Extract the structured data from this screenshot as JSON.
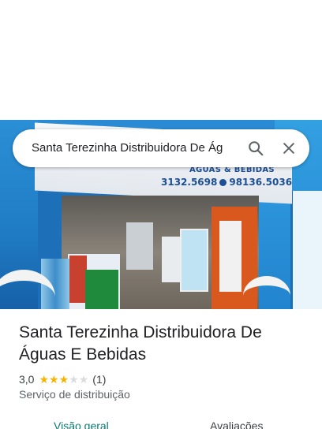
{
  "search": {
    "value": "Santa Terezinha Distribuidora De Ág",
    "search_icon": "search-icon",
    "close_icon": "close-icon"
  },
  "hero": {
    "sign_line": "ÁGUAS & BEBIDAS",
    "sign_phone_1": "3132.5698",
    "sign_phone_2": "98136.5036"
  },
  "place": {
    "title": "Santa Terezinha Distribuidora De Águas E Bebidas",
    "rating": "3,0",
    "rating_value": 3,
    "rating_max": 5,
    "review_count": "(1)",
    "category": "Serviço de distribuição"
  },
  "tabs": [
    {
      "label": "Visão geral",
      "active": true
    },
    {
      "label": "Avaliações",
      "active": false
    }
  ],
  "colors": {
    "star_on": "#f4b400",
    "star_off": "#dadce0",
    "active_tab": "#0b7a75"
  }
}
